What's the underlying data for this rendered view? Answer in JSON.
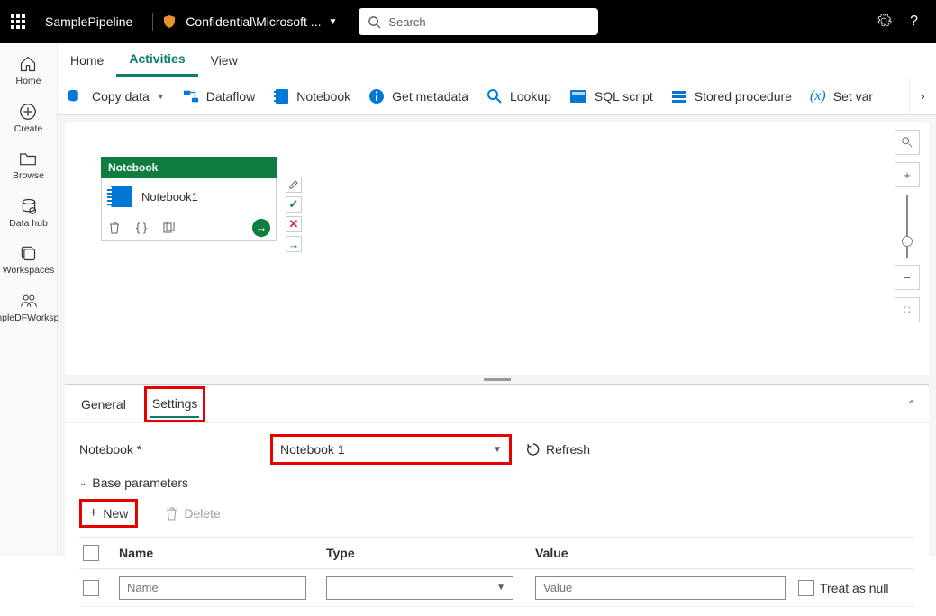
{
  "top": {
    "pipeline": "SamplePipeline",
    "workspace": "Confidential\\Microsoft ...",
    "search_placeholder": "Search"
  },
  "rail": [
    {
      "name": "home",
      "label": "Home"
    },
    {
      "name": "create",
      "label": "Create"
    },
    {
      "name": "browse",
      "label": "Browse"
    },
    {
      "name": "datahub",
      "label": "Data hub"
    },
    {
      "name": "workspaces",
      "label": "Workspaces"
    },
    {
      "name": "sampledfw",
      "label": "SampleDFWorkspace"
    }
  ],
  "tabs": [
    "Home",
    "Activities",
    "View"
  ],
  "active_tab": "Activities",
  "ribbon": [
    {
      "name": "copy-data",
      "label": "Copy data",
      "has_chev": true
    },
    {
      "name": "dataflow",
      "label": "Dataflow"
    },
    {
      "name": "notebook",
      "label": "Notebook"
    },
    {
      "name": "get-metadata",
      "label": "Get metadata"
    },
    {
      "name": "lookup",
      "label": "Lookup"
    },
    {
      "name": "sql-script",
      "label": "SQL script"
    },
    {
      "name": "stored-procedure",
      "label": "Stored procedure"
    },
    {
      "name": "set-variable",
      "label": "Set var"
    }
  ],
  "node": {
    "head": "Notebook",
    "title": "Notebook1"
  },
  "prop_tabs": [
    "General",
    "Settings"
  ],
  "active_prop_tab": "Settings",
  "settings": {
    "notebook_label": "Notebook",
    "notebook_value": "Notebook 1",
    "refresh": "Refresh",
    "section": "Base parameters",
    "new_btn": "New",
    "delete_btn": "Delete",
    "cols": {
      "name": "Name",
      "type": "Type",
      "value": "Value"
    },
    "placeholders": {
      "name": "Name",
      "type": "",
      "value": "Value"
    },
    "treat_as_null": "Treat as null"
  }
}
